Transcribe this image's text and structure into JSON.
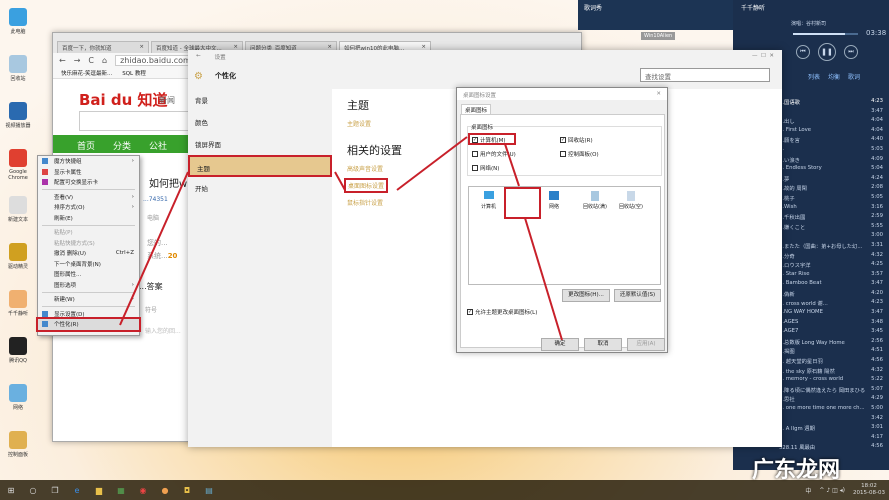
{
  "desktop_icons": [
    "此电脑",
    "回收站",
    "视频播放器",
    "Google Chrome",
    "新建文本",
    "驱动精灵",
    "千千静听",
    "腾讯QQ",
    "网络",
    "控制面板"
  ],
  "browser": {
    "tabs": [
      "百度一下，你就知道",
      "百度知道 - 全球最大中文...",
      "问题分类_百度知道",
      "如何把win10的此电脑..."
    ],
    "url": "zhidao.baidu.com/",
    "bookmarks": [
      "快乐麻花-笑逗最新...",
      "SQL 教程"
    ],
    "logo": "Bai du 知道",
    "nav_link": "新闻",
    "green_nav": [
      "首页",
      "分类",
      "公社"
    ],
    "question_title": "如何把w",
    "user": "...74351",
    "tag": "电脑",
    "line1": "您的...",
    "line2": "系统...",
    "year": "20",
    "answer_header": "...答案",
    "toolbar": "符号",
    "reply_placeholder": "输入您的回..."
  },
  "context_menu": {
    "items": [
      {
        "label": "魔方快捷组",
        "arrow": true
      },
      {
        "label": "显示卡属性"
      },
      {
        "label": "配置可交换显示卡"
      },
      {
        "sep": true
      },
      {
        "label": "查看(V)",
        "arrow": true
      },
      {
        "label": "排序方式(O)",
        "arrow": true
      },
      {
        "label": "刷新(E)"
      },
      {
        "sep": true
      },
      {
        "label": "粘贴(P)",
        "disabled": true
      },
      {
        "label": "粘贴快捷方式(S)",
        "disabled": true
      },
      {
        "label": "撤消 删除(U)",
        "shortcut": "Ctrl+Z"
      },
      {
        "label": "下一个桌面背景(N)"
      },
      {
        "label": "图形属性..."
      },
      {
        "label": "图形选项",
        "arrow": true
      },
      {
        "sep": true
      },
      {
        "label": "新建(W)",
        "arrow": true
      },
      {
        "sep": true
      },
      {
        "label": "显示设置(D)"
      },
      {
        "label": "个性化(R)",
        "highlight": true
      }
    ]
  },
  "settings": {
    "title": "设置",
    "section": "个性化",
    "search_placeholder": "查找设置",
    "nav": [
      "背景",
      "颜色",
      "锁屏界面",
      "主题",
      "开始"
    ],
    "heading": "主题",
    "theme_link": "主题设置",
    "related_heading": "相关的设置",
    "links": [
      "高级声音设置",
      "桌面图标设置",
      "鼠标指针设置"
    ],
    "version_badge": "Win10Alien"
  },
  "dialog": {
    "title": "桌面图标设置",
    "tab": "桌面图标",
    "group": "桌面图标",
    "checkboxes": [
      {
        "label": "计算机(M)",
        "checked": true
      },
      {
        "label": "回收站(R)",
        "checked": true
      },
      {
        "label": "用户的文件(U)",
        "checked": false
      },
      {
        "label": "控制面板(O)",
        "checked": false
      },
      {
        "label": "网络(N)",
        "checked": false
      }
    ],
    "icons": [
      "计算机",
      "网络",
      "回收站(满)",
      "回收站(空)"
    ],
    "change_icon": "更改图标(H)...",
    "restore": "还原默认值(S)",
    "allow_themes": "允许主题更改桌面图标(L)",
    "ok": "确定",
    "cancel": "取消",
    "apply": "应用(A)"
  },
  "lyric_window": {
    "title": "歌词秀"
  },
  "player": {
    "app": "千千静听",
    "artist": "演唱：谷村新司",
    "time": "03:38",
    "progress": 0.8,
    "tabs": [
      "列表",
      "均衡",
      "歌词"
    ],
    "playlist_header": "...国语歌",
    "songs": [
      [
        "",
        "3:47"
      ],
      [
        "...出し",
        "4:04"
      ],
      [
        "... First Love",
        "4:04"
      ],
      [
        "...願を言",
        "4:40"
      ],
      [
        "...",
        "5:03"
      ],
      [
        "...い涙き",
        "4:09"
      ],
      [
        "... Endless Story",
        "5:04"
      ],
      [
        "...夢",
        "4:24"
      ],
      [
        "...故的 周閑",
        "2:08"
      ],
      [
        "...桃子",
        "5:05"
      ],
      [
        "...Wish",
        "3:16"
      ],
      [
        "...千秋出國",
        "2:59"
      ],
      [
        "...嫌くこと",
        "5:55"
      ],
      [
        "",
        "3:00"
      ],
      [
        "...またた（国曲：弟+お母した幻...",
        "3:31"
      ],
      [
        "...分奇",
        "4:32"
      ],
      [
        "...ロウス宇洋",
        "4:25"
      ],
      [
        "... Star Rise",
        "3:57"
      ],
      [
        "... Bamboo Beat",
        "3:47"
      ],
      [
        "...偽新",
        "4:20"
      ],
      [
        "... cross world 谢...",
        "4:23"
      ],
      [
        "...NG WAY HOME",
        "3:47"
      ],
      [
        "...AGES",
        "3:48"
      ],
      [
        "...AGE7",
        "3:45"
      ],
      [
        "...总数版 Long Way Home",
        "2:56"
      ],
      [
        "...揭图",
        "4:51"
      ],
      [
        "... 越天堂的星日羽",
        "4:56"
      ],
      [
        "... the sky 原石籍 陽然",
        "4:32"
      ],
      [
        "... memory - cross world",
        "5:22"
      ],
      [
        "...降る頃に偶然逢えたら 岡田まひる",
        "5:07"
      ],
      [
        "...思社",
        "4:29"
      ],
      [
        "... one more time one more ch...",
        "5:00"
      ],
      [
        "",
        "3:42"
      ],
      [
        "... A Ilgm 週期",
        "3:01"
      ],
      [
        "",
        "4:17"
      ],
      [
        "328.11 風最由",
        "4:56"
      ]
    ],
    "header_time": "4:23"
  },
  "taskbar": {
    "time": "18:02",
    "date": "2015-08-03",
    "ime": "中"
  },
  "watermark": "广东龙网"
}
